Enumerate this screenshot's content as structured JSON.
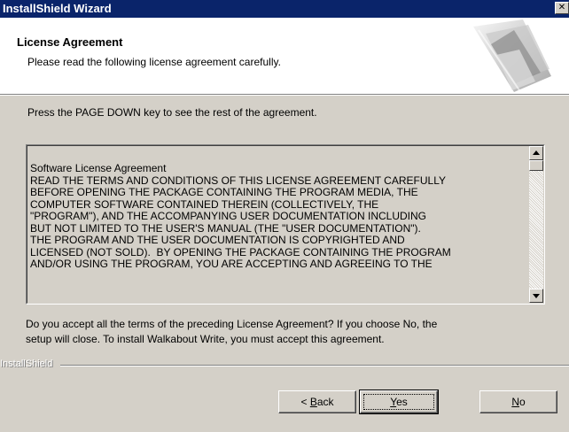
{
  "window": {
    "title": "InstallShield Wizard",
    "close_glyph": "✕"
  },
  "header": {
    "title": "License Agreement",
    "subtitle": "Please read the following license agreement carefully.",
    "graphic_icon": "installshield-pages-graphic"
  },
  "instruction": "Press the PAGE DOWN key to see the rest of the agreement.",
  "license": {
    "lines": [
      "Software License Agreement",
      "READ THE TERMS AND CONDITIONS OF THIS LICENSE AGREEMENT CAREFULLY",
      "BEFORE OPENING THE PACKAGE CONTAINING THE PROGRAM MEDIA, THE",
      "COMPUTER SOFTWARE CONTAINED THEREIN (COLLECTIVELY, THE",
      "\"PROGRAM\"), AND THE ACCOMPANYING USER DOCUMENTATION INCLUDING",
      "BUT NOT LIMITED TO THE USER'S MANUAL (THE \"USER DOCUMENTATION\").",
      "THE PROGRAM AND THE USER DOCUMENTATION IS COPYRIGHTED AND",
      "LICENSED (NOT SOLD).  BY OPENING THE PACKAGE CONTAINING THE PROGRAM",
      "AND/OR USING THE PROGRAM, YOU ARE ACCEPTING AND AGREEING TO THE"
    ]
  },
  "question": {
    "line1": "Do you accept all the terms of the preceding License Agreement?  If you choose No,  the",
    "line2": "setup will close.  To install Walkabout Write, you must accept this agreement."
  },
  "brand": "InstallShield",
  "buttons": {
    "back": {
      "prefix": "< ",
      "mnemonic": "B",
      "rest": "ack"
    },
    "yes": {
      "mnemonic": "Y",
      "rest": "es"
    },
    "no": {
      "mnemonic": "N",
      "rest": "o"
    }
  }
}
